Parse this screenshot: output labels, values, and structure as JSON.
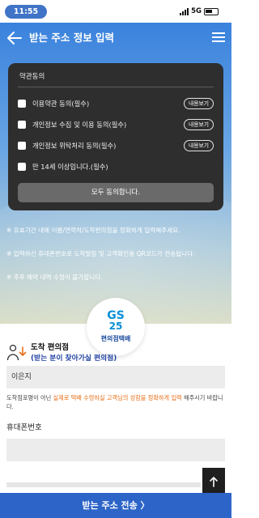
{
  "status_bar": {
    "time": "11:55",
    "network": "5G"
  },
  "header": {
    "title": "받는 주소 정보 입력"
  },
  "terms": {
    "title": "약관동의",
    "items": [
      {
        "label": "이용약관 동의(필수)",
        "view_label": "내용보기"
      },
      {
        "label": "개인정보 수집 및 이용 동의(필수)",
        "view_label": "내용보기"
      },
      {
        "label": "개인정보 위탁처리 동의(필수)",
        "view_label": "내용보기"
      },
      {
        "label": "만 14세 이상입니다.(필수)"
      }
    ],
    "agree_all_label": "모두 동의합니다."
  },
  "notices": [
    "※ 유효기간 내에 이름/연락처/도착편의점을 정확하게 입력해주세요.",
    "※ 입력하신 휴대폰번호로 도착알림 및 고객확인용 QR코드가 전송됩니다.",
    "※ 추후 예약 내역 수정이 불가합니다."
  ],
  "badge": {
    "line1": "GS",
    "line2": "25",
    "line3": "편의점택배"
  },
  "store": {
    "title": "도착 편의점",
    "subtitle": "(받는 분이 찾아가실 편의점)"
  },
  "form": {
    "name_value": "이은지",
    "help_prefix": "도착점포명이 아닌 ",
    "help_emphasis": "실제로 택배 수령하실 고객님의 성함을 정확하게 입력",
    "help_suffix": " 해주시기 바랍니다.",
    "phone_label": "휴대폰번호",
    "phone_value": ""
  },
  "submit": {
    "label": "받는 주소 전송 〉"
  },
  "colors": {
    "primary": "#2d64c8",
    "panel": "#2e2e2e",
    "emphasis": "#e96e17",
    "accent_navy": "#2042a3"
  }
}
